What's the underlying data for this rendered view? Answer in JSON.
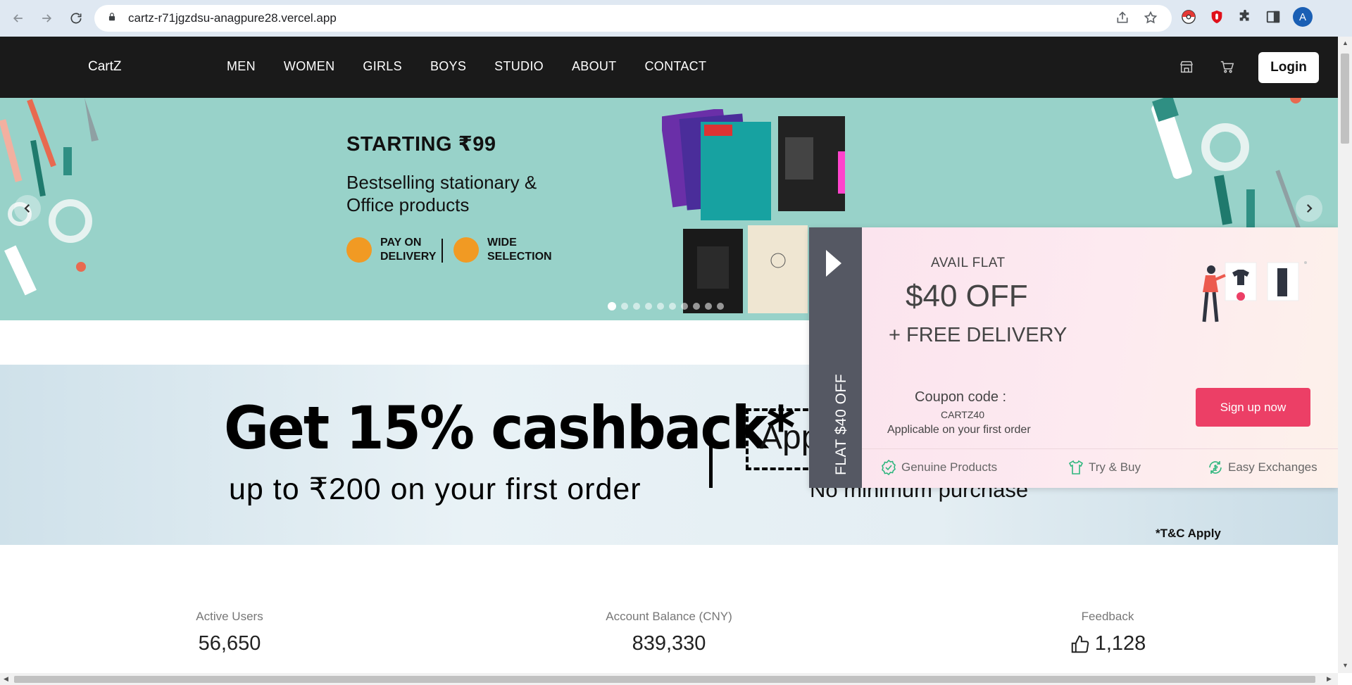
{
  "browser": {
    "url": "cartz-r71jgzdsu-anagpure28.vercel.app",
    "avatar_letter": "A"
  },
  "header": {
    "logo": "CartZ",
    "nav": [
      "MEN",
      "WOMEN",
      "GIRLS",
      "BOYS",
      "STUDIO",
      "ABOUT",
      "CONTACT"
    ],
    "login_label": "Login"
  },
  "hero": {
    "title": "STARTING ₹99",
    "subtitle": "Bestselling stationary & Office products",
    "badges": [
      "PAY ON DELIVERY",
      "WIDE SELECTION"
    ],
    "slide_count": 10,
    "active_slide": 0,
    "bg_color": "#98d2c9"
  },
  "cashback": {
    "title": "Get 15% cashback*",
    "subtitle": "up to ₹200 on your first order",
    "apply": "App",
    "min": "No minimum purchase",
    "tc": "*T&C Apply"
  },
  "stats": [
    {
      "label": "Active Users",
      "value": "56,650"
    },
    {
      "label": "Account Balance (CNY)",
      "value": "839,330"
    },
    {
      "label": "Feedback",
      "value": "1,128",
      "icon": "thumbs-up-icon"
    }
  ],
  "popup": {
    "side_label": "FLAT $40 OFF",
    "avail": "AVAIL FLAT",
    "off": "$40 OFF",
    "free": "+ FREE DELIVERY",
    "coupon_label": "Coupon code :",
    "coupon_code": "CARTZ40",
    "coupon_note": "Applicable on your first order",
    "signup_label": "Sign up now",
    "perks": [
      "Genuine Products",
      "Try & Buy",
      "Easy Exchanges"
    ],
    "accent": "#ec3f66",
    "perk_color": "#2eb67d"
  }
}
